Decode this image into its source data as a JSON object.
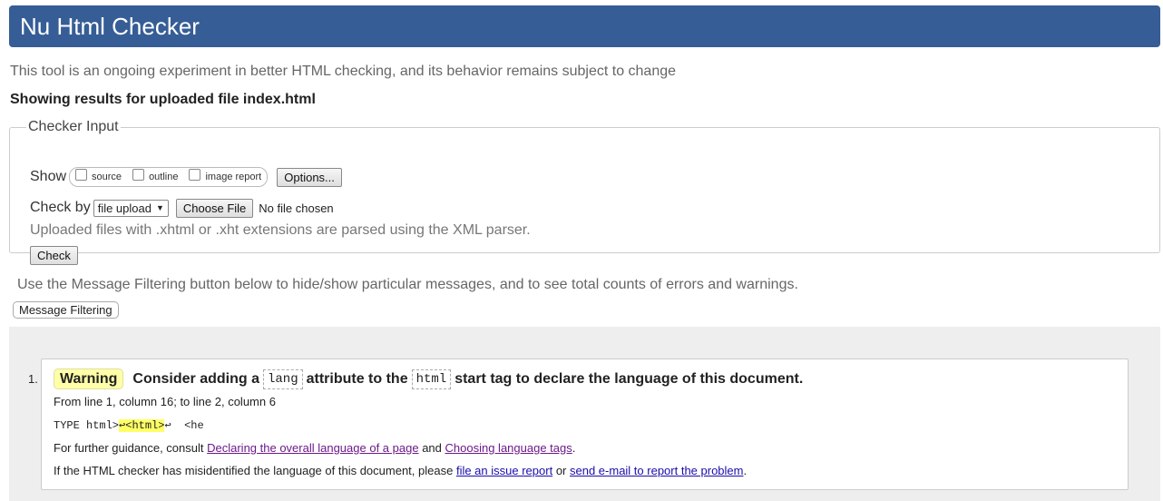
{
  "header": {
    "title": "Nu Html Checker"
  },
  "intro": "This tool is an ongoing experiment in better HTML checking, and its behavior remains subject to change",
  "results_heading": "Showing results for uploaded file index.html",
  "checker_input": {
    "legend": "Checker Input",
    "show_label": "Show",
    "show_options": [
      "source",
      "outline",
      "image report"
    ],
    "options_button": "Options...",
    "check_by_label": "Check by",
    "check_by_value": "file upload",
    "choose_file_button": "Choose File",
    "no_file_text": "No file chosen",
    "xml_note": "Uploaded files with .xhtml or .xht extensions are parsed using the XML parser.",
    "check_button": "Check"
  },
  "filtering": {
    "note": "Use the Message Filtering button below to hide/show particular messages, and to see total counts of errors and warnings.",
    "button": "Message Filtering"
  },
  "messages": [
    {
      "number": "1.",
      "type": "Warning",
      "title_parts": [
        "Consider adding a",
        "lang",
        "attribute to the",
        "html",
        "start tag to declare the language of this document."
      ],
      "location": "From line 1, column 16; to line 2, column 6",
      "extract_pre": "TYPE html>",
      "extract_highlight": "↩<html>",
      "extract_post": "↩  <he",
      "guidance_pre": "For further guidance, consult",
      "guidance_link1": "Declaring the overall language of a page",
      "guidance_and": "and",
      "guidance_link2": "Choosing language tags",
      "guidance_end": ".",
      "misid_pre": "If the HTML checker has misidentified the language of this document, please",
      "misid_link1": "file an issue report",
      "misid_or": "or",
      "misid_link2": "send e-mail to report the problem",
      "misid_end": "."
    }
  ],
  "colors": {
    "header_bg": "#365d95",
    "warning_badge": "#ffffa8",
    "highlight": "#ffff66"
  }
}
